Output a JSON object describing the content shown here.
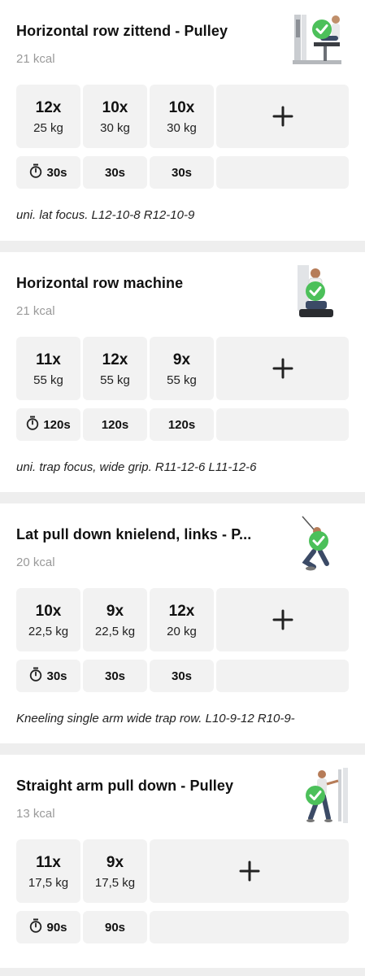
{
  "exercises": [
    {
      "name": "Horizontal row zittend - Pulley",
      "kcal": "21 kcal",
      "image_icon": "seated-row-machine-icon",
      "sets": [
        {
          "reps": "12x",
          "weight": "25 kg",
          "rest": "30s"
        },
        {
          "reps": "10x",
          "weight": "30 kg",
          "rest": "30s"
        },
        {
          "reps": "10x",
          "weight": "30 kg",
          "rest": "30s"
        }
      ],
      "note": "uni. lat focus. L12-10-8 R12-10-9"
    },
    {
      "name": "Horizontal row machine",
      "kcal": "21 kcal",
      "image_icon": "row-machine-icon",
      "sets": [
        {
          "reps": "11x",
          "weight": "55 kg",
          "rest": "120s"
        },
        {
          "reps": "12x",
          "weight": "55 kg",
          "rest": "120s"
        },
        {
          "reps": "9x",
          "weight": "55 kg",
          "rest": "120s"
        }
      ],
      "note": "uni. trap focus, wide grip. R11-12-6 L11-12-6"
    },
    {
      "name": "Lat pull down knielend, links - P...",
      "kcal": "20 kcal",
      "image_icon": "kneeling-pulldown-icon",
      "sets": [
        {
          "reps": "10x",
          "weight": "22,5 kg",
          "rest": "30s"
        },
        {
          "reps": "9x",
          "weight": "22,5 kg",
          "rest": "30s"
        },
        {
          "reps": "12x",
          "weight": "20 kg",
          "rest": "30s"
        }
      ],
      "note": "Kneeling single arm wide trap row. L10-9-12 R10-9-"
    },
    {
      "name": "Straight arm pull down - Pulley",
      "kcal": "13 kcal",
      "image_icon": "straight-arm-pulldown-icon",
      "sets": [
        {
          "reps": "11x",
          "weight": "17,5 kg",
          "rest": "90s"
        },
        {
          "reps": "9x",
          "weight": "17,5 kg",
          "rest": "90s"
        }
      ],
      "note": ""
    }
  ],
  "colors": {
    "check_green": "#4cc05a",
    "cell_bg": "#f2f2f2",
    "page_bg": "#eeeeee",
    "muted_text": "#9a9a9a"
  },
  "icons": {
    "add": "plus-icon",
    "rest": "stopwatch-icon",
    "completed": "checkmark-icon"
  }
}
